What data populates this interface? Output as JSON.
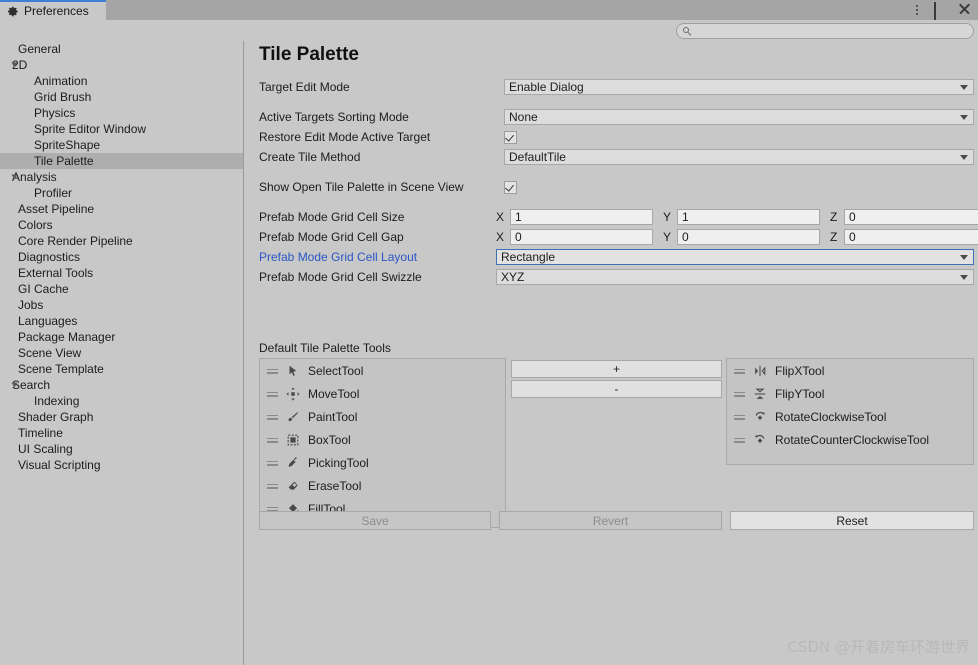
{
  "window": {
    "tab_label": "Preferences",
    "tab_icon": "gear-icon",
    "controls": [
      {
        "name": "kebab-menu-icon",
        "label": "⋮"
      },
      {
        "name": "maximize-icon",
        "label": "❐"
      },
      {
        "name": "close-icon",
        "label": "✕"
      }
    ]
  },
  "search": {
    "icon": "search-icon",
    "value": "",
    "placeholder": ""
  },
  "sidebar": {
    "items": [
      {
        "label": "General",
        "indent": 1,
        "expandable": false,
        "selected": false
      },
      {
        "label": "2D",
        "indent": 0,
        "expandable": true,
        "selected": false
      },
      {
        "label": "Animation",
        "indent": 2,
        "expandable": false,
        "selected": false
      },
      {
        "label": "Grid Brush",
        "indent": 2,
        "expandable": false,
        "selected": false
      },
      {
        "label": "Physics",
        "indent": 2,
        "expandable": false,
        "selected": false
      },
      {
        "label": "Sprite Editor Window",
        "indent": 2,
        "expandable": false,
        "selected": false
      },
      {
        "label": "SpriteShape",
        "indent": 2,
        "expandable": false,
        "selected": false
      },
      {
        "label": "Tile Palette",
        "indent": 2,
        "expandable": false,
        "selected": true
      },
      {
        "label": "Analysis",
        "indent": 0,
        "expandable": true,
        "selected": false
      },
      {
        "label": "Profiler",
        "indent": 2,
        "expandable": false,
        "selected": false
      },
      {
        "label": "Asset Pipeline",
        "indent": 1,
        "expandable": false,
        "selected": false
      },
      {
        "label": "Colors",
        "indent": 1,
        "expandable": false,
        "selected": false
      },
      {
        "label": "Core Render Pipeline",
        "indent": 1,
        "expandable": false,
        "selected": false
      },
      {
        "label": "Diagnostics",
        "indent": 1,
        "expandable": false,
        "selected": false
      },
      {
        "label": "External Tools",
        "indent": 1,
        "expandable": false,
        "selected": false
      },
      {
        "label": "GI Cache",
        "indent": 1,
        "expandable": false,
        "selected": false
      },
      {
        "label": "Jobs",
        "indent": 1,
        "expandable": false,
        "selected": false
      },
      {
        "label": "Languages",
        "indent": 1,
        "expandable": false,
        "selected": false
      },
      {
        "label": "Package Manager",
        "indent": 1,
        "expandable": false,
        "selected": false
      },
      {
        "label": "Scene View",
        "indent": 1,
        "expandable": false,
        "selected": false
      },
      {
        "label": "Scene Template",
        "indent": 1,
        "expandable": false,
        "selected": false
      },
      {
        "label": "Search",
        "indent": 0,
        "expandable": true,
        "selected": false
      },
      {
        "label": "Indexing",
        "indent": 2,
        "expandable": false,
        "selected": false
      },
      {
        "label": "Shader Graph",
        "indent": 1,
        "expandable": false,
        "selected": false
      },
      {
        "label": "Timeline",
        "indent": 1,
        "expandable": false,
        "selected": false
      },
      {
        "label": "UI Scaling",
        "indent": 1,
        "expandable": false,
        "selected": false
      },
      {
        "label": "Visual Scripting",
        "indent": 1,
        "expandable": false,
        "selected": false
      }
    ]
  },
  "main": {
    "title": "Tile Palette",
    "settings": [
      {
        "label": "Target Edit Mode",
        "type": "dropdown",
        "value": "Enable Dialog",
        "gap_after": true
      },
      {
        "label": "Active Targets Sorting Mode",
        "type": "dropdown",
        "value": "None"
      },
      {
        "label": "Restore Edit Mode Active Target",
        "type": "checkbox",
        "checked": true
      },
      {
        "label": "Create Tile Method",
        "type": "dropdown",
        "value": "DefaultTile",
        "gap_after": true
      },
      {
        "label": "Show Open Tile Palette in Scene View",
        "type": "checkbox",
        "checked": true,
        "gap_after": true
      }
    ],
    "vectors": [
      {
        "label": "Prefab Mode Grid Cell Size",
        "x": "1",
        "y": "1",
        "z": "0"
      },
      {
        "label": "Prefab Mode Grid Cell Gap",
        "x": "0",
        "y": "0",
        "z": "0"
      }
    ],
    "layout_row": {
      "label": "Prefab Mode Grid Cell Layout",
      "value": "Rectangle",
      "accent": true,
      "focused": true
    },
    "swizzle_row": {
      "label": "Prefab Mode Grid Cell Swizzle",
      "value": "XYZ"
    },
    "tools_section_title": "Default Tile Palette Tools",
    "tools_left": [
      {
        "label": "SelectTool",
        "icon": "cursor-arrow-icon"
      },
      {
        "label": "MoveTool",
        "icon": "move-icon"
      },
      {
        "label": "PaintTool",
        "icon": "brush-icon"
      },
      {
        "label": "BoxTool",
        "icon": "box-select-icon"
      },
      {
        "label": "PickingTool",
        "icon": "eyedropper-icon"
      },
      {
        "label": "EraseTool",
        "icon": "eraser-icon"
      },
      {
        "label": "FillTool",
        "icon": "paint-bucket-icon"
      }
    ],
    "tools_right": [
      {
        "label": "FlipXTool",
        "icon": "flip-horizontal-icon"
      },
      {
        "label": "FlipYTool",
        "icon": "flip-vertical-icon"
      },
      {
        "label": "RotateClockwiseTool",
        "icon": "rotate-cw-icon"
      },
      {
        "label": "RotateCounterClockwiseTool",
        "icon": "rotate-ccw-icon"
      }
    ],
    "add_button": "+",
    "remove_button": "-",
    "footer": {
      "save": "Save",
      "revert": "Revert",
      "reset": "Reset"
    }
  },
  "watermark": "CSDN @开着房车环游世界",
  "colors": {
    "background": "#c8c8c8",
    "titlebar": "#a5a5a5",
    "tab_accent": "#3c7fd4",
    "selection": "#aeaeae",
    "accent_label": "#2a56c6",
    "field": "#dcdcdc",
    "focus_border": "#3f6fb5"
  }
}
